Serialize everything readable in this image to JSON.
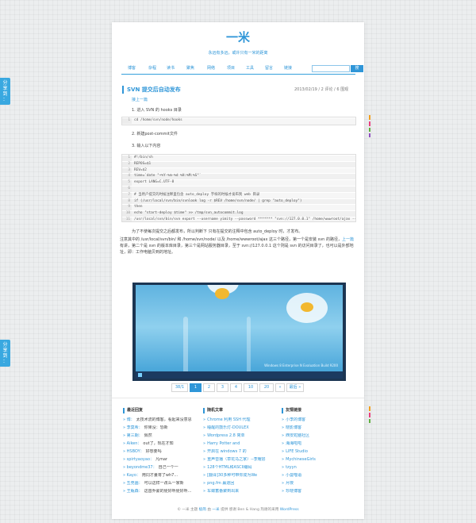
{
  "share": {
    "label_chars": [
      "分",
      "享",
      "到",
      "："
    ]
  },
  "accent_color": "#2f96d8",
  "site": {
    "title": "一米",
    "tagline": "永远有多远，或许只有一米的距离"
  },
  "nav": {
    "items": [
      "博客",
      "杂程",
      "读书",
      "聚焦",
      "网络",
      "项目",
      "工具",
      "留言",
      "链接"
    ],
    "search_placeholder": "",
    "search_button": "搜"
  },
  "post": {
    "title": "SVN 提交后自动发布",
    "meta": "2013/02/19 / 2 评论 / 6 围观",
    "prev_link": "接上一篇",
    "step1": "1. 进入 SVN 的 hooks 目录",
    "code1": [
      {
        "n": "1",
        "t": "cd /home/svn/node/hooks"
      }
    ],
    "step2": "2. 新建post-commit文件",
    "step3": "3. 输入以下内容",
    "code2": [
      {
        "n": "1",
        "t": "#!/bin/sh"
      },
      {
        "n": "2",
        "t": "REPOS=$1"
      },
      {
        "n": "3",
        "t": "REV=$2"
      },
      {
        "n": "4",
        "t": "time=`date \"+%Y-%m-%d %H:%M:%S\"`"
      },
      {
        "n": "5",
        "t": "export LANG=C.UTF-8"
      },
      {
        "n": "6",
        "t": ""
      },
      {
        "n": "7",
        "t": "# 当用户提交的时候注释里包含 auto_deploy 字样的时候才发布到 web 目录"
      },
      {
        "n": "8",
        "t": "if (/usr/local/svn/bin/svnlook log -r $REV /home/svn/node/ | grep \"auto_deploy\")"
      },
      {
        "n": "9",
        "t": "then"
      },
      {
        "n": "10",
        "t": "echo \"start-deploy $time\" >> /tmp/svn_autocommit.log"
      },
      {
        "n": "11",
        "t": "/usr/local/svn/bin/svn export --username yimity --password ******* \"svn://127.0.0.1\" /home/wwwroot/ajax --force"
      },
      {
        "n": "12",
        "t": "fi"
      }
    ],
    "desc_1": "为了不使每次提交之后都发布，所以判断下 只有在提交的注释中包含 auto_deploy 时，才发布。",
    "desc_2": "注意其中的 /usr/local/svn/bin/ 和 /home/svn/node/ 以及 /home/wwwroot/ajax 这三个路径，第一个是安装 svn 的路径，",
    "desc_link": "上一篇",
    "desc_3": "有讲，第二个是 svn 的版本库目录，第三个是网站服务器目录，至于 svn://127.0.0.1 这个则是 svn 的访问目录了，也可以是外部地址，即：工作电脑贝到的地址。",
    "image_caption": "Windows 8 Enterprise N Evaluation Build 9200"
  },
  "pager": {
    "items": [
      "38/1",
      "1",
      "2",
      "3",
      "4",
      "10",
      "20",
      "»",
      "最后 »"
    ],
    "current": "1"
  },
  "footer_cols": [
    {
      "heading": "最近回复",
      "items": [
        {
          "b": "» 博：",
          "t": "太技术流的博客，看起来没意思"
        },
        {
          "b": "» 李莫希：",
          "t": "你果没：恐新"
        },
        {
          "b": "» 第三期：",
          "t": "佩然"
        },
        {
          "b": "» Aiken：",
          "t": "out了，现在才知"
        },
        {
          "b": "» HSBOY：",
          "t": "好想要吗"
        },
        {
          "b": "» spirtyaoyao：",
          "t": "凡mar"
        },
        {
          "b": "» beyondme37：",
          "t": "自己一个一"
        },
        {
          "b": "» Kayo：",
          "t": "用同才董将了wh7..."
        },
        {
          "b": "» 五竞画：",
          "t": "可以这样一改么一家新"
        },
        {
          "b": "» 王甄森：",
          "t": "这首乔蒙的便好听便好听..."
        }
      ]
    },
    {
      "heading": "随机文章",
      "items": [
        {
          "b": "»",
          "t": "Chrome 利用 SSH 代理"
        },
        {
          "b": "»",
          "t": "睡醒的鼓乐灯-DOULEX"
        },
        {
          "b": "»",
          "t": "Wordpress 2.8 简单"
        },
        {
          "b": "»",
          "t": "Harry Potter and"
        },
        {
          "b": "»",
          "t": "开启在 windows 7 的"
        },
        {
          "b": "»",
          "t": "重声音播（草花马之家）--李耀层"
        },
        {
          "b": "»",
          "t": "128个HTML和ASCII编码"
        },
        {
          "b": "»",
          "t": "[翻译]30多种可带你成为We"
        },
        {
          "b": "»",
          "t": "png.fm 赢道回"
        },
        {
          "b": "»",
          "t": "车蝶蓄番聚到出来"
        }
      ]
    },
    {
      "heading": "友情链接",
      "items": [
        {
          "b": "»",
          "t": "小李的博客"
        },
        {
          "b": "»",
          "t": "晓影博客"
        },
        {
          "b": "»",
          "t": "西安蛇脑社区"
        },
        {
          "b": "»",
          "t": "海海啦啦"
        },
        {
          "b": "»",
          "t": "LIFE Studio"
        },
        {
          "b": "»",
          "t": "MychineseGirls"
        },
        {
          "b": "»",
          "t": "tzyyn"
        },
        {
          "b": "»",
          "t": "小曼喵语"
        },
        {
          "b": "»",
          "t": "月夜"
        },
        {
          "b": "»",
          "t": "珍晓博客"
        }
      ]
    }
  ],
  "footer": {
    "copy": "© 一米 主题",
    "theme_link": "极简",
    "mid": "由",
    "author_link": "一米",
    "host_prefix": "提供 感谢 Ben & Hang 热谢的采用",
    "wp_link": "WordPress"
  }
}
